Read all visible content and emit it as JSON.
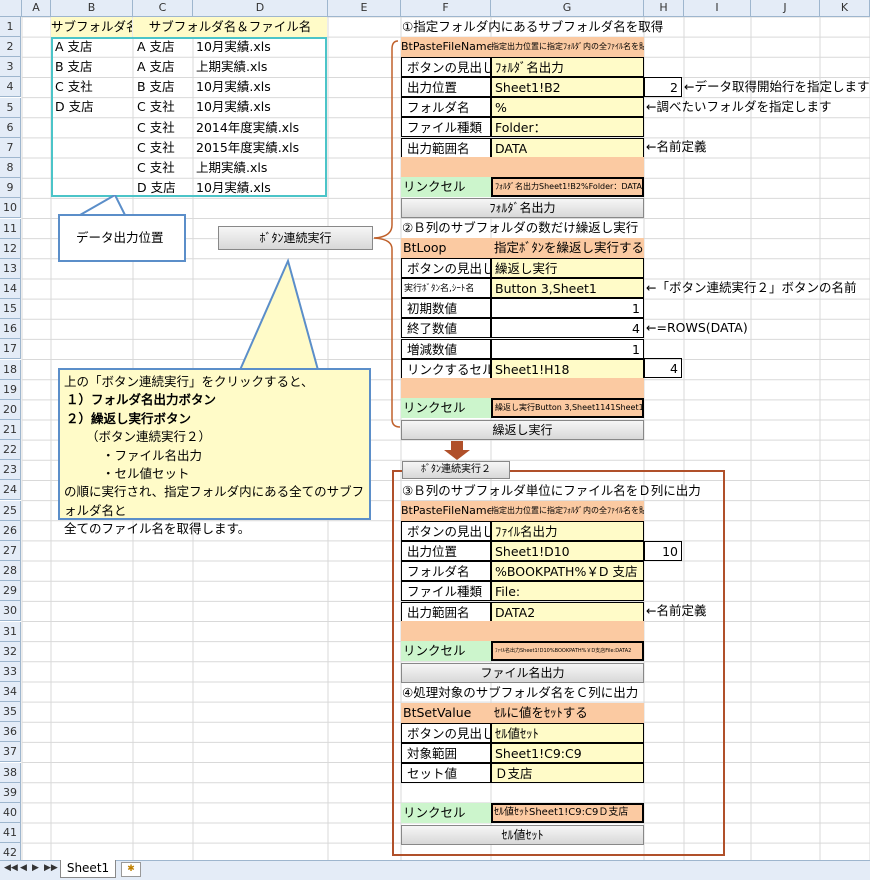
{
  "columns": [
    "A",
    "B",
    "C",
    "D",
    "E",
    "F",
    "G",
    "H",
    "I",
    "J",
    "K"
  ],
  "rows": [
    "1",
    "2",
    "3",
    "4",
    "5",
    "6",
    "7",
    "8",
    "9",
    "10",
    "11",
    "12",
    "13",
    "14",
    "15",
    "16",
    "17",
    "18",
    "19",
    "20",
    "21",
    "22",
    "23",
    "24",
    "25",
    "26",
    "27",
    "28",
    "29",
    "30",
    "31",
    "32",
    "33",
    "34",
    "35",
    "36",
    "37",
    "38",
    "39",
    "40",
    "41",
    "42"
  ],
  "left_table": {
    "header_b": "サブフォルダ名",
    "header_cd": "サブフォルダ名＆ファイル名",
    "col_b": [
      "A 支店",
      "B 支店",
      "C 支社",
      "D 支店"
    ],
    "col_c": [
      "A 支店",
      "A 支店",
      "B 支店",
      "C 支社",
      "C 支社",
      "C 支社",
      "C 支社",
      "D 支店"
    ],
    "col_d": [
      "10月実績.xls",
      "上期実績.xls",
      "10月実績.xls",
      "10月実績.xls",
      "2014年度実績.xls",
      "2015年度実績.xls",
      "上期実績.xls",
      "10月実績.xls"
    ]
  },
  "callout_output": "データ出力位置",
  "button_main": "ﾎﾞﾀﾝ連続実行",
  "callout_main": {
    "line1": "上の「ボタン連続実行」をクリックすると、",
    "line2": "１）フォルダ名出力ボタン",
    "line3": "２）繰返し実行ボタン",
    "line4": "（ボタン連続実行２）",
    "line5": "・ファイル名出力",
    "line6": "・セル値セット",
    "line7": "の順に実行され、指定フォルダ内にある全てのサブフォルダ名と",
    "line8": "全てのファイル名を取得します。"
  },
  "sec1": {
    "title": "①指定フォルダ内にあるサブフォルダ名を取得",
    "header": "BtPasteFileName",
    "header_note": "指定出力位置に指定ﾌｫﾙﾀﾞ内の全ﾌｧｲﾙ名を貼付",
    "labels": [
      "ボタンの見出し",
      "出力位置",
      "フォルダ名",
      "ファイル種類",
      "出力範囲名"
    ],
    "values": [
      "ﾌｫﾙﾀﾞ名出力",
      "Sheet1!B2",
      "%",
      "Folder：",
      "DATA"
    ],
    "h4": "2",
    "notes": [
      "←データ取得開始行を指定します",
      "←調べたいフォルダを指定します",
      "←名前定義"
    ],
    "link_label": "リンクセル",
    "link_value": "ﾌｫﾙﾀﾞ名出力Sheet1!B2%Folder：DATA",
    "button": "ﾌｫﾙﾀﾞ名出力"
  },
  "sec2": {
    "title": "②Ｂ列のサブフォルダの数だけ繰返し実行",
    "header": "BtLoop",
    "header_note": "指定ﾎﾞﾀﾝを繰返し実行する",
    "labels": [
      "ボタンの見出し",
      "実行ﾎﾞﾀﾝ名,ｼｰﾄ名",
      "初期数値",
      "終了数値",
      "増減数値",
      "リンクするセル"
    ],
    "values": [
      "繰返し実行",
      "Button 3,Sheet1",
      "1",
      "4",
      "1",
      "Sheet1!H18"
    ],
    "h18": "4",
    "notes": [
      "←「ボタン連続実行２」ボタンの名前",
      "←=ROWS(DATA)"
    ],
    "link_label": "リンクセル",
    "link_value": "繰返し実行Button 3,Sheet1141Sheet1!H18",
    "button": "繰返し実行"
  },
  "button_2": "ﾎﾞﾀﾝ連続実行２",
  "sec3": {
    "title": "③Ｂ列のサブフォルダ単位にファイル名をＤ列に出力",
    "header": "BtPasteFileName",
    "header_note": "指定出力位置に指定ﾌｫﾙﾀﾞ内の全ﾌｧｲﾙ名を貼付",
    "labels": [
      "ボタンの見出し",
      "出力位置",
      "フォルダ名",
      "ファイル種類",
      "出力範囲名"
    ],
    "values": [
      "ﾌｧｲﾙ名出力",
      "Sheet1!D10",
      "%BOOKPATH%￥D 支店",
      "File:",
      "DATA2"
    ],
    "h27": "10",
    "notes": [
      "←名前定義"
    ],
    "link_label": "リンクセル",
    "link_value": "ﾌｧｲﾙ名出力Sheet1!D10%BOOKPATH%￥D支店File:DATA2",
    "button": "ファイル名出力"
  },
  "sec4": {
    "title": "④処理対象のサブフォルダ名をＣ列に出力",
    "header": "BtSetValue",
    "header_note": "ｾﾙに値をｾｯﾄする",
    "labels": [
      "ボタンの見出し",
      "対象範囲",
      "セット値"
    ],
    "values": [
      "ｾﾙ値ｾｯﾄ",
      "Sheet1!C9:C9",
      "Ｄ支店"
    ],
    "link_label": "リンクセル",
    "link_value": "ｾﾙ値ｾｯﾄSheet1!C9:C9Ｄ支店",
    "button": "ｾﾙ値ｾｯﾄ"
  },
  "sheet_tab": "Sheet1"
}
